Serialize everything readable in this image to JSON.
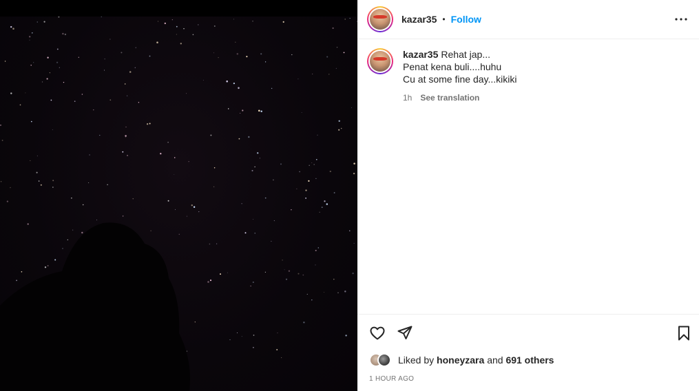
{
  "post": {
    "username": "kazar35",
    "follow_label": "Follow",
    "separator": "•",
    "more_icon": "more-horizontal-icon"
  },
  "caption": {
    "username": "kazar35",
    "line1": "Rehat jap...",
    "line2": "Penat kena buli....huhu",
    "line3": "Cu at some fine day...kikiki",
    "age": "1h",
    "see_translation": "See translation"
  },
  "actions": {
    "like_icon": "heart-icon",
    "share_icon": "send-icon",
    "save_icon": "bookmark-icon"
  },
  "likes": {
    "prefix": "Liked by",
    "user": "honeyzara",
    "middle": "and",
    "others": "691 others"
  },
  "timestamp": "1 HOUR AGO",
  "colors": {
    "accent": "#0095f6",
    "text": "#262626",
    "muted": "#737373",
    "photo_bg": "#0a060b"
  }
}
